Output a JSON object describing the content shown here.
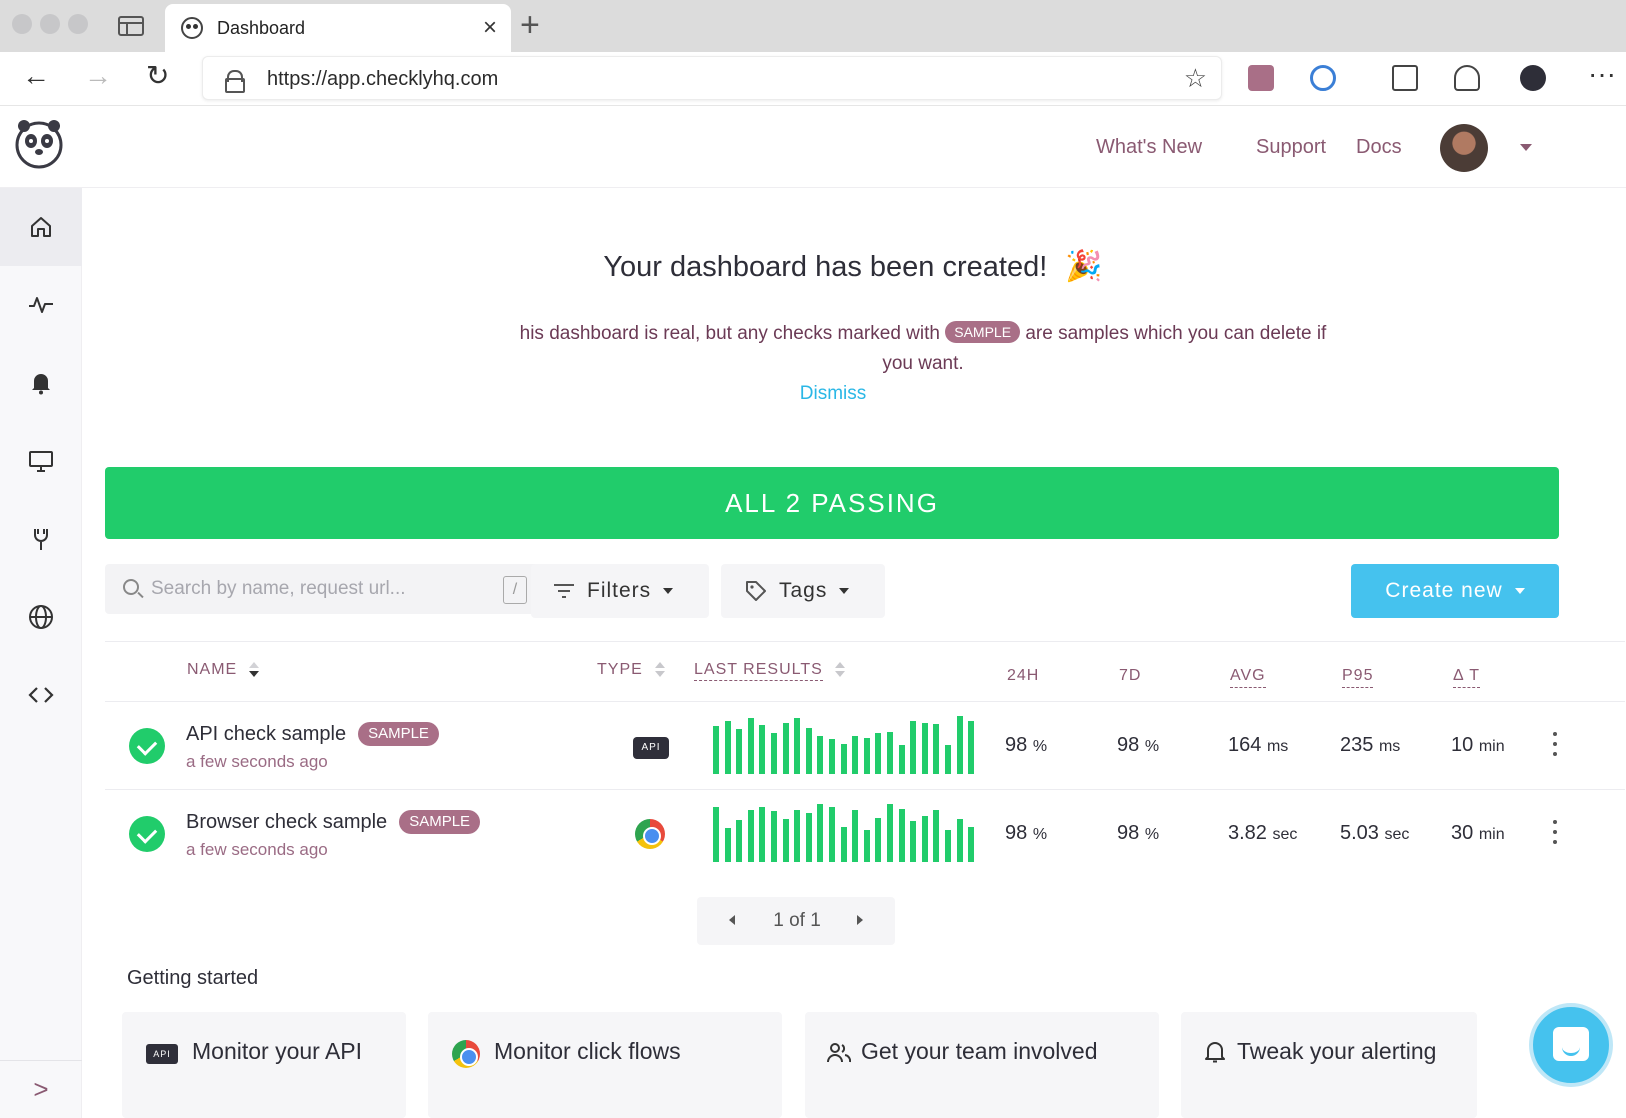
{
  "browser": {
    "tab_title": "Dashboard",
    "url": "https://app.checklyhq.com"
  },
  "header": {
    "links": [
      "What's New",
      "Support",
      "Docs"
    ]
  },
  "sidebar": {
    "items": [
      {
        "icon": "home-icon",
        "active": true
      },
      {
        "icon": "activity-icon",
        "active": false
      },
      {
        "icon": "bell-icon",
        "active": false
      },
      {
        "icon": "monitor-icon",
        "active": false
      },
      {
        "icon": "wrench-icon",
        "active": false
      },
      {
        "icon": "globe-icon",
        "active": false
      },
      {
        "icon": "code-icon",
        "active": false
      }
    ],
    "expand_icon": ">"
  },
  "welcome": {
    "title": "Your dashboard has been created!",
    "text_before": "his dashboard is real, but any checks marked with",
    "sample_pill": "SAMPLE",
    "text_after": "are samples which you can delete if you want.",
    "dismiss": "Dismiss"
  },
  "status_banner": "ALL 2 PASSING",
  "filters": {
    "search_placeholder": "Search by name, request url...",
    "search_shortcut": "/",
    "filters_label": "Filters",
    "tags_label": "Tags",
    "create_label": "Create new"
  },
  "table": {
    "headers": {
      "name": "NAME",
      "type": "TYPE",
      "last_results": "LAST RESULTS",
      "h24": "24H",
      "d7": "7D",
      "avg": "AVG",
      "p95": "P95",
      "dt": "Δ T"
    },
    "rows": [
      {
        "name": "API check sample",
        "badge": "SAMPLE",
        "time": "a few seconds ago",
        "type": "API",
        "status": "passing",
        "results": [
          0.82,
          0.92,
          0.78,
          0.96,
          0.85,
          0.7,
          0.88,
          0.96,
          0.8,
          0.66,
          0.6,
          0.52,
          0.66,
          0.62,
          0.7,
          0.72,
          0.5,
          0.92,
          0.88,
          0.86,
          0.5,
          1.0,
          0.92
        ],
        "h24": "98",
        "h24_unit": "%",
        "d7": "98",
        "d7_unit": "%",
        "avg": "164",
        "avg_unit": "ms",
        "p95": "235",
        "p95_unit": "ms",
        "dt": "10",
        "dt_unit": "min"
      },
      {
        "name": "Browser check sample",
        "badge": "SAMPLE",
        "time": "a few seconds ago",
        "type": "browser",
        "status": "passing",
        "results": [
          0.94,
          0.58,
          0.72,
          0.9,
          0.94,
          0.88,
          0.74,
          0.9,
          0.84,
          1.0,
          0.94,
          0.6,
          0.9,
          0.56,
          0.76,
          1.0,
          0.92,
          0.7,
          0.8,
          0.9,
          0.56,
          0.74,
          0.6
        ],
        "h24": "98",
        "h24_unit": "%",
        "d7": "98",
        "d7_unit": "%",
        "avg": "3.82",
        "avg_unit": "sec",
        "p95": "5.03",
        "p95_unit": "sec",
        "dt": "30",
        "dt_unit": "min"
      }
    ]
  },
  "pagination": {
    "label": "1 of 1"
  },
  "getting_started": {
    "title": "Getting started",
    "cards": [
      "Monitor your API",
      "Monitor click flows",
      "Get your team involved",
      "Tweak your alerting"
    ],
    "api_badge": "API"
  },
  "colors": {
    "passing_green": "#21cc6b",
    "accent_blue": "#45c2ee",
    "brand_mauve": "#8a5a72",
    "sample_pill": "#a96f87"
  }
}
